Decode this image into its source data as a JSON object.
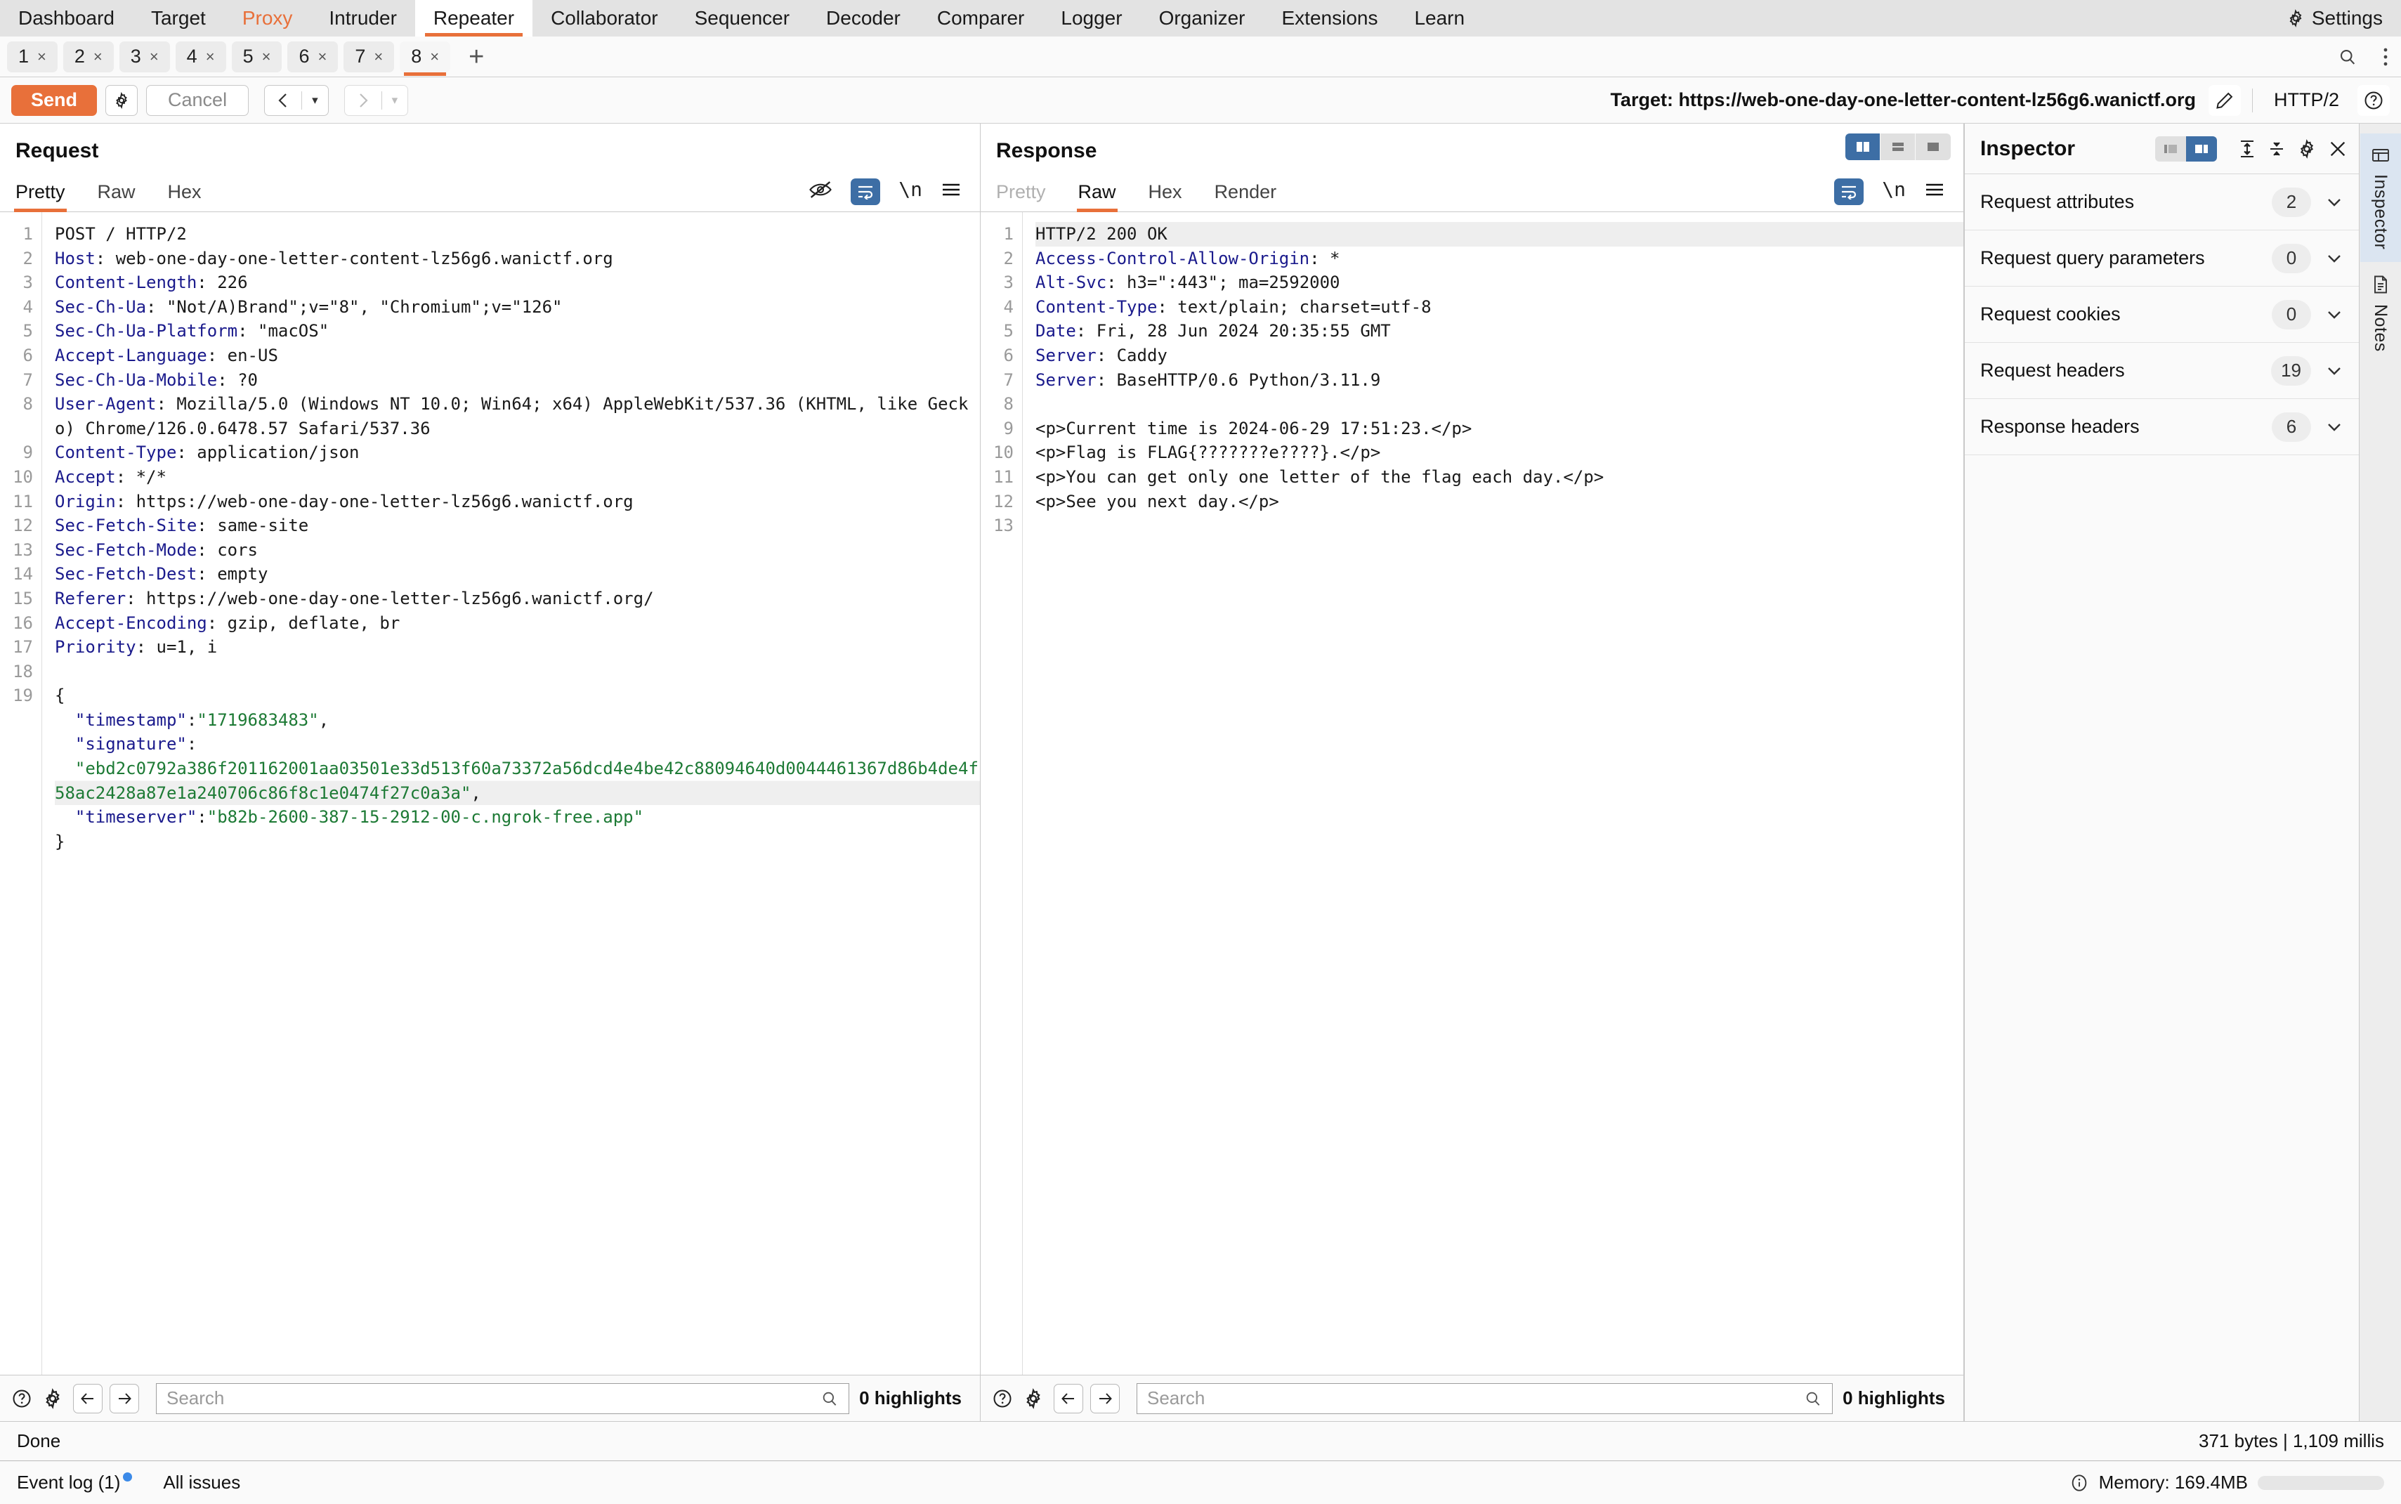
{
  "menubar": {
    "items": [
      {
        "label": "Dashboard",
        "state": "normal"
      },
      {
        "label": "Target",
        "state": "normal"
      },
      {
        "label": "Proxy",
        "state": "highlight"
      },
      {
        "label": "Intruder",
        "state": "normal"
      },
      {
        "label": "Repeater",
        "state": "active"
      },
      {
        "label": "Collaborator",
        "state": "normal"
      },
      {
        "label": "Sequencer",
        "state": "normal"
      },
      {
        "label": "Decoder",
        "state": "normal"
      },
      {
        "label": "Comparer",
        "state": "normal"
      },
      {
        "label": "Logger",
        "state": "normal"
      },
      {
        "label": "Organizer",
        "state": "normal"
      },
      {
        "label": "Extensions",
        "state": "normal"
      },
      {
        "label": "Learn",
        "state": "normal"
      }
    ],
    "settings_label": "Settings",
    "settings_icon": "gear-icon"
  },
  "repeater_tabs": {
    "tabs": [
      {
        "label": "1",
        "close": "×",
        "active": false
      },
      {
        "label": "2",
        "close": "×",
        "active": false
      },
      {
        "label": "3",
        "close": "×",
        "active": false
      },
      {
        "label": "4",
        "close": "×",
        "active": false
      },
      {
        "label": "5",
        "close": "×",
        "active": false
      },
      {
        "label": "6",
        "close": "×",
        "active": false
      },
      {
        "label": "7",
        "close": "×",
        "active": false
      },
      {
        "label": "8",
        "close": "×",
        "active": true
      }
    ],
    "add_label": "+",
    "search_icon": "search-icon",
    "overflow_icon": "kebab-menu-icon"
  },
  "actionbar": {
    "send_label": "Send",
    "send_settings_icon": "gear-icon",
    "cancel_label": "Cancel",
    "prev_icon": "chevron-left-icon",
    "next_icon": "chevron-right-icon",
    "caret": "▾",
    "target_label": "Target: https://web-one-day-one-letter-content-lz56g6.wanictf.org",
    "edit_icon": "pencil-icon",
    "http_version": "HTTP/2",
    "help_icon": "question-circle-icon",
    "accent_color": "#e8703a"
  },
  "request": {
    "title": "Request",
    "tabs": [
      {
        "label": "Pretty",
        "active": true,
        "muted": false
      },
      {
        "label": "Raw",
        "active": false,
        "muted": false
      },
      {
        "label": "Hex",
        "active": false,
        "muted": false
      }
    ],
    "icons": [
      "eye-off-icon",
      "word-wrap-icon",
      "newline-icon",
      "hamburger-menu-icon"
    ],
    "lines": [
      {
        "n": "1",
        "segments": [
          {
            "t": "POST / HTTP/2",
            "c": "plain"
          }
        ]
      },
      {
        "n": "2",
        "segments": [
          {
            "t": "Host",
            "c": "hdr"
          },
          {
            "t": ": web-one-day-one-letter-content-lz56g6.wanictf.org",
            "c": "plain"
          }
        ]
      },
      {
        "n": "3",
        "segments": [
          {
            "t": "Content-Length",
            "c": "hdr"
          },
          {
            "t": ": 226",
            "c": "plain"
          }
        ]
      },
      {
        "n": "4",
        "segments": [
          {
            "t": "Sec-Ch-Ua",
            "c": "hdr"
          },
          {
            "t": ": \"Not/A)Brand\";v=\"8\", \"Chromium\";v=\"126\"",
            "c": "plain"
          }
        ]
      },
      {
        "n": "5",
        "segments": [
          {
            "t": "Sec-Ch-Ua-Platform",
            "c": "hdr"
          },
          {
            "t": ": \"macOS\"",
            "c": "plain"
          }
        ]
      },
      {
        "n": "6",
        "segments": [
          {
            "t": "Accept-Language",
            "c": "hdr"
          },
          {
            "t": ": en-US",
            "c": "plain"
          }
        ]
      },
      {
        "n": "7",
        "segments": [
          {
            "t": "Sec-Ch-Ua-Mobile",
            "c": "hdr"
          },
          {
            "t": ": ?0",
            "c": "plain"
          }
        ]
      },
      {
        "n": "8",
        "segments": [
          {
            "t": "User-Agent",
            "c": "hdr"
          },
          {
            "t": ": Mozilla/5.0 (Windows NT 10.0; Win64; x64) AppleWebKit/537.36 (KHTML, like Gecko) Chrome/126.0.6478.57 Safari/537.36",
            "c": "plain"
          }
        ],
        "wrap": 2
      },
      {
        "n": "9",
        "segments": [
          {
            "t": "Content-Type",
            "c": "hdr"
          },
          {
            "t": ": application/json",
            "c": "plain"
          }
        ]
      },
      {
        "n": "10",
        "segments": [
          {
            "t": "Accept",
            "c": "hdr"
          },
          {
            "t": ": */*",
            "c": "plain"
          }
        ]
      },
      {
        "n": "11",
        "segments": [
          {
            "t": "Origin",
            "c": "hdr"
          },
          {
            "t": ": https://web-one-day-one-letter-lz56g6.wanictf.org",
            "c": "plain"
          }
        ]
      },
      {
        "n": "12",
        "segments": [
          {
            "t": "Sec-Fetch-Site",
            "c": "hdr"
          },
          {
            "t": ": same-site",
            "c": "plain"
          }
        ]
      },
      {
        "n": "13",
        "segments": [
          {
            "t": "Sec-Fetch-Mode",
            "c": "hdr"
          },
          {
            "t": ": cors",
            "c": "plain"
          }
        ]
      },
      {
        "n": "14",
        "segments": [
          {
            "t": "Sec-Fetch-Dest",
            "c": "hdr"
          },
          {
            "t": ": empty",
            "c": "plain"
          }
        ]
      },
      {
        "n": "15",
        "segments": [
          {
            "t": "Referer",
            "c": "hdr"
          },
          {
            "t": ": https://web-one-day-one-letter-lz56g6.wanictf.org/",
            "c": "plain"
          }
        ]
      },
      {
        "n": "16",
        "segments": [
          {
            "t": "Accept-Encoding",
            "c": "hdr"
          },
          {
            "t": ": gzip, deflate, br",
            "c": "plain"
          }
        ]
      },
      {
        "n": "17",
        "segments": [
          {
            "t": "Priority",
            "c": "hdr"
          },
          {
            "t": ": u=1, i",
            "c": "plain"
          }
        ]
      },
      {
        "n": "18",
        "segments": [
          {
            "t": "",
            "c": "plain"
          }
        ]
      },
      {
        "n": "19",
        "segments": [
          {
            "t": "{",
            "c": "plain"
          }
        ]
      },
      {
        "n": "",
        "segments": [
          {
            "t": "  \"timestamp\"",
            "c": "key"
          },
          {
            "t": ":",
            "c": "plain"
          },
          {
            "t": "\"1719683483\"",
            "c": "str"
          },
          {
            "t": ",",
            "c": "plain"
          }
        ]
      },
      {
        "n": "",
        "segments": [
          {
            "t": "  \"signature\"",
            "c": "key"
          },
          {
            "t": ":",
            "c": "plain"
          }
        ]
      },
      {
        "n": "",
        "segments": [
          {
            "t": "  \"ebd2c0792a386f201162001aa03501e33d513f60a73372a56dcd4e4be42c88094640d0044461367d86b4de4f58ac2428a87e1a240706c86f8c1e0474f27c0a3a\"",
            "c": "str"
          },
          {
            "t": ",",
            "c": "plain"
          }
        ],
        "wrap": 2,
        "highlight_last": true
      },
      {
        "n": "",
        "segments": [
          {
            "t": "  \"timeserver\"",
            "c": "key"
          },
          {
            "t": ":",
            "c": "plain"
          },
          {
            "t": "\"b82b-2600-387-15-2912-00-c.ngrok-free.app\"",
            "c": "str"
          }
        ]
      },
      {
        "n": "",
        "segments": [
          {
            "t": "}",
            "c": "plain"
          }
        ]
      }
    ],
    "search_placeholder": "Search",
    "search_value": "",
    "highlights": "0 highlights",
    "help_icon": "question-circle-icon",
    "settings_icon": "gear-icon",
    "back_icon": "arrow-left-icon",
    "forward_icon": "arrow-right-icon",
    "search_icon": "search-icon"
  },
  "response": {
    "title": "Response",
    "tabs": [
      {
        "label": "Pretty",
        "active": false,
        "muted": true
      },
      {
        "label": "Raw",
        "active": true,
        "muted": false
      },
      {
        "label": "Hex",
        "active": false,
        "muted": false
      },
      {
        "label": "Render",
        "active": false,
        "muted": false
      }
    ],
    "icons": [
      "word-wrap-icon",
      "newline-icon",
      "hamburger-menu-icon"
    ],
    "layout_segments": [
      {
        "name": "split-vertical-icon",
        "active": true
      },
      {
        "name": "split-horizontal-icon",
        "active": false
      },
      {
        "name": "single-pane-icon",
        "active": false
      }
    ],
    "lines": [
      {
        "n": "1",
        "segments": [
          {
            "t": "HTTP/2 200 OK",
            "c": "plain"
          }
        ],
        "highlight": true
      },
      {
        "n": "2",
        "segments": [
          {
            "t": "Access-Control-Allow-Origin",
            "c": "hdr"
          },
          {
            "t": ": *",
            "c": "plain"
          }
        ]
      },
      {
        "n": "3",
        "segments": [
          {
            "t": "Alt-Svc",
            "c": "hdr"
          },
          {
            "t": ": h3=\":443\"; ma=2592000",
            "c": "plain"
          }
        ]
      },
      {
        "n": "4",
        "segments": [
          {
            "t": "Content-Type",
            "c": "hdr"
          },
          {
            "t": ": text/plain; charset=utf-8",
            "c": "plain"
          }
        ]
      },
      {
        "n": "5",
        "segments": [
          {
            "t": "Date",
            "c": "hdr"
          },
          {
            "t": ": Fri, 28 Jun 2024 20:35:55 GMT",
            "c": "plain"
          }
        ]
      },
      {
        "n": "6",
        "segments": [
          {
            "t": "Server",
            "c": "hdr"
          },
          {
            "t": ": Caddy",
            "c": "plain"
          }
        ]
      },
      {
        "n": "7",
        "segments": [
          {
            "t": "Server",
            "c": "hdr"
          },
          {
            "t": ": BaseHTTP/0.6 Python/3.11.9",
            "c": "plain"
          }
        ]
      },
      {
        "n": "8",
        "segments": [
          {
            "t": "",
            "c": "plain"
          }
        ]
      },
      {
        "n": "9",
        "segments": [
          {
            "t": "<p>Current time is 2024-06-29 17:51:23.</p>",
            "c": "plain"
          }
        ]
      },
      {
        "n": "10",
        "segments": [
          {
            "t": "<p>Flag is FLAG{???????e????}.</p>",
            "c": "plain"
          }
        ]
      },
      {
        "n": "11",
        "segments": [
          {
            "t": "<p>You can get only one letter of the flag each day.</p>",
            "c": "plain"
          }
        ]
      },
      {
        "n": "12",
        "segments": [
          {
            "t": "<p>See you next day.</p>",
            "c": "plain"
          }
        ]
      },
      {
        "n": "13",
        "segments": [
          {
            "t": "",
            "c": "plain"
          }
        ]
      }
    ],
    "search_placeholder": "Search",
    "search_value": "",
    "highlights": "0 highlights",
    "help_icon": "question-circle-icon",
    "settings_icon": "gear-icon",
    "back_icon": "arrow-left-icon",
    "forward_icon": "arrow-right-icon",
    "search_icon": "search-icon"
  },
  "inspector": {
    "title": "Inspector",
    "toggle_segments": [
      {
        "name": "inspector-left-layout-icon",
        "active": false
      },
      {
        "name": "inspector-right-layout-icon",
        "active": true
      }
    ],
    "icons": [
      "expand-all-icon",
      "collapse-all-icon",
      "gear-icon",
      "close-icon"
    ],
    "rows": [
      {
        "label": "Request attributes",
        "count": "2"
      },
      {
        "label": "Request query parameters",
        "count": "0"
      },
      {
        "label": "Request cookies",
        "count": "0"
      },
      {
        "label": "Request headers",
        "count": "19"
      },
      {
        "label": "Response headers",
        "count": "6"
      }
    ]
  },
  "rightrail": {
    "items": [
      {
        "label": "Inspector",
        "icon": "inspector-icon",
        "active": true
      },
      {
        "label": "Notes",
        "icon": "notes-document-icon",
        "active": false
      }
    ]
  },
  "statusbar": {
    "status": "Done",
    "metrics": "371 bytes | 1,109 millis"
  },
  "bottombar": {
    "event_log": "Event log (1)",
    "all_issues": "All issues",
    "memory": "Memory: 169.4MB",
    "info_icon": "info-circle-icon"
  }
}
